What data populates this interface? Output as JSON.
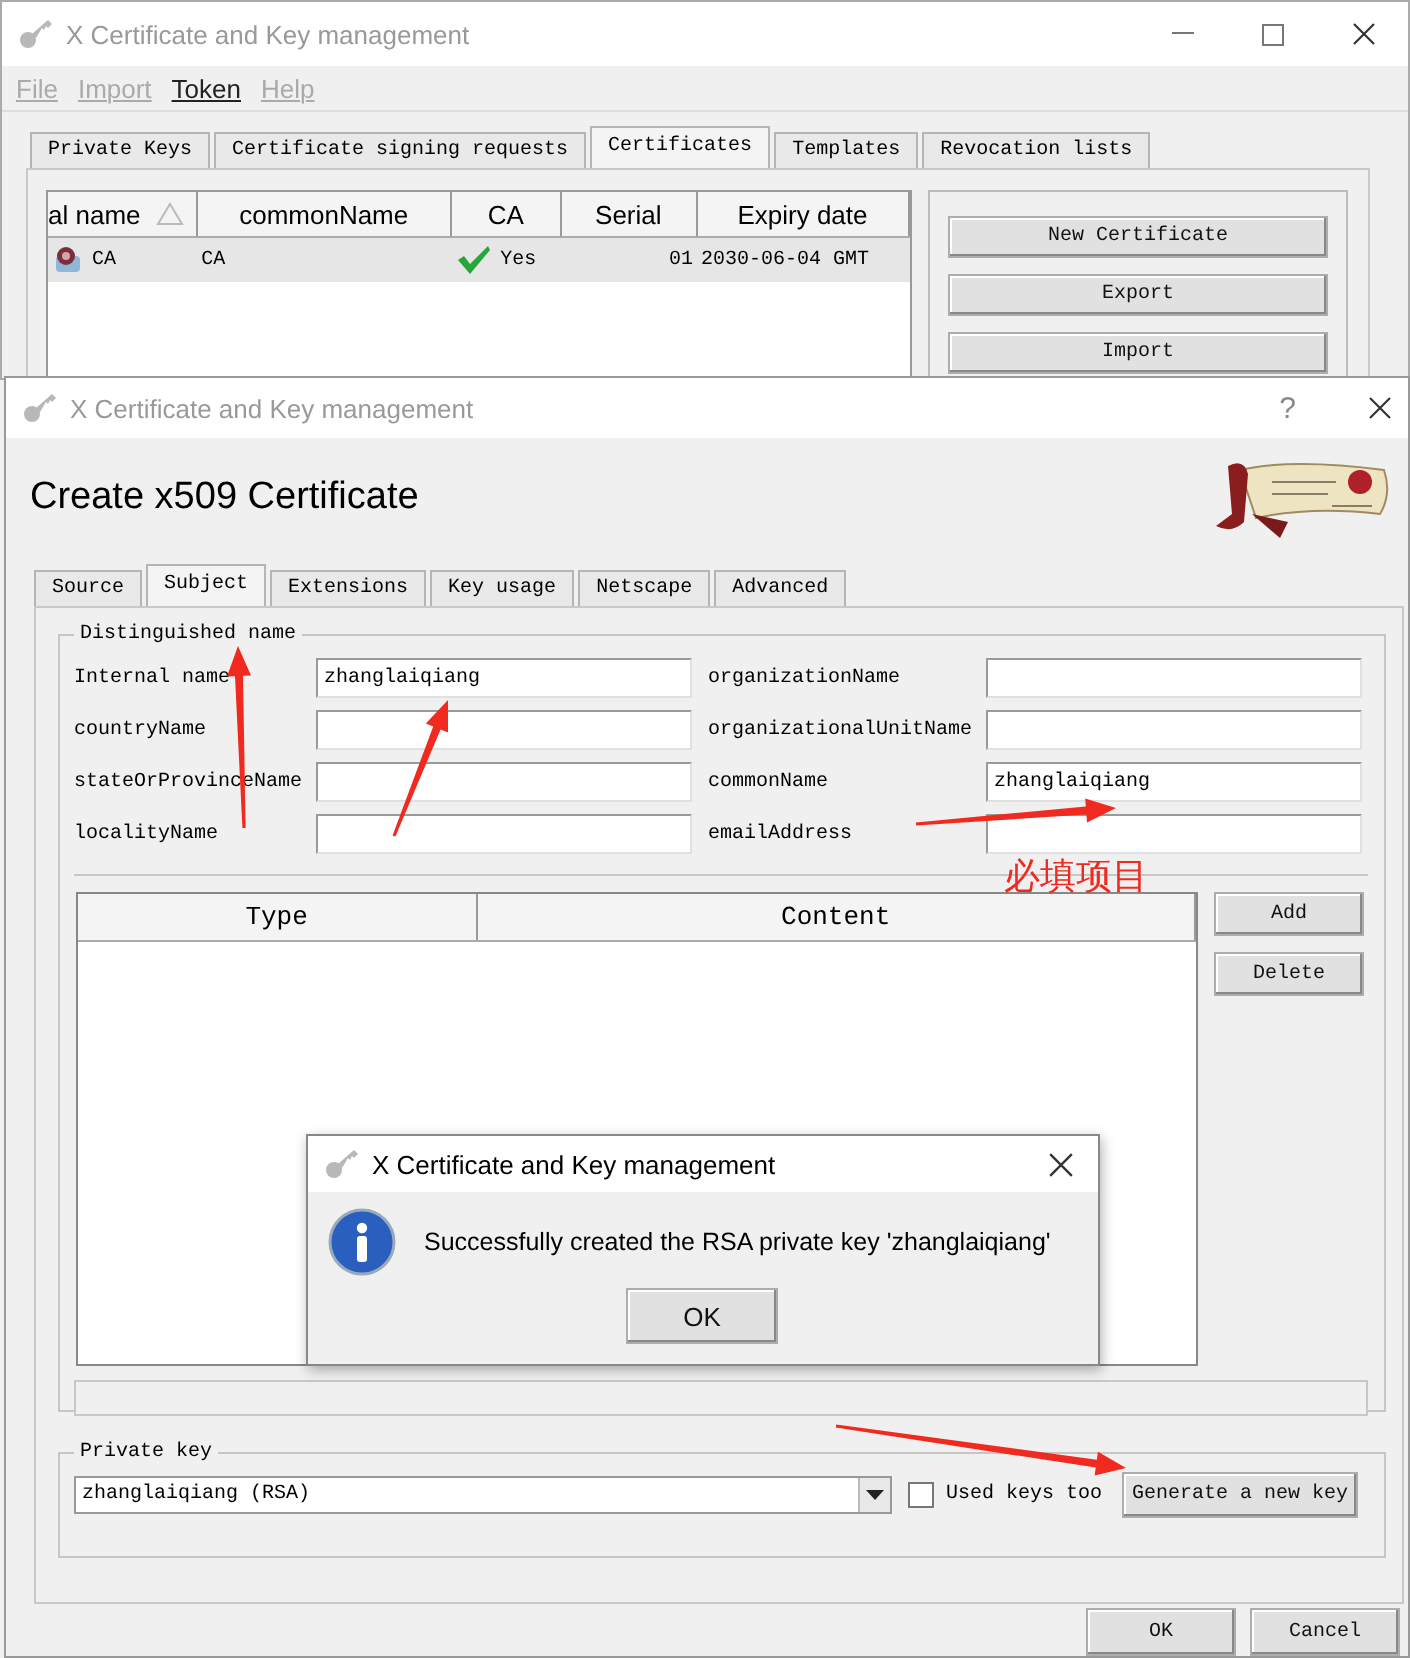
{
  "main_window": {
    "title": "X Certificate and Key management",
    "menu": [
      {
        "label": "File",
        "disabled": true
      },
      {
        "label": "Import",
        "disabled": true
      },
      {
        "label": "Token",
        "disabled": false
      },
      {
        "label": "Help",
        "disabled": true
      }
    ],
    "tabs": [
      {
        "label": "Private Keys",
        "selected": false
      },
      {
        "label": "Certificate signing requests",
        "selected": false
      },
      {
        "label": "Certificates",
        "selected": true
      },
      {
        "label": "Templates",
        "selected": false
      },
      {
        "label": "Revocation lists",
        "selected": false
      }
    ],
    "table": {
      "columns": [
        "al name",
        "commonName",
        "CA",
        "Serial",
        "Expiry date"
      ],
      "rows": [
        {
          "selected": true,
          "ca": true,
          "cells": [
            "CA",
            "CA",
            "Yes",
            "01",
            "2030-06-04 GMT"
          ]
        }
      ]
    },
    "buttons": [
      "New Certificate",
      "Export",
      "Import"
    ]
  },
  "dialog": {
    "title": "X Certificate and Key management",
    "help_button": "?",
    "heading": "Create x509 Certificate",
    "tabs": [
      {
        "label": "Source",
        "selected": false
      },
      {
        "label": "Subject",
        "selected": true
      },
      {
        "label": "Extensions",
        "selected": false
      },
      {
        "label": "Key usage",
        "selected": false
      },
      {
        "label": "Netscape",
        "selected": false
      },
      {
        "label": "Advanced",
        "selected": false
      }
    ],
    "distinguished_name": {
      "legend": "Distinguished name",
      "fields": [
        {
          "label": "Internal name",
          "value": "zhanglaiqiang"
        },
        {
          "label": "organizationName"
        },
        {
          "label": "countryName"
        },
        {
          "label": "organizationalUnitName"
        },
        {
          "label": "stateOrProvinceName"
        },
        {
          "label": "commonName",
          "value": "zhanglaiqiang"
        },
        {
          "label": "localityName"
        },
        {
          "label": "emailAddress"
        }
      ],
      "table": {
        "columns": [
          "Type",
          "Content"
        ]
      },
      "buttons": [
        "Add",
        "Delete"
      ]
    },
    "private_key": {
      "legend": "Private key",
      "selection": "zhanglaiqiang (RSA)",
      "used_keys_too": {
        "label": "Used keys too",
        "checked": false
      },
      "button": "Generate a new key"
    },
    "footer_buttons": [
      "OK",
      "Cancel"
    ]
  },
  "message_box": {
    "title": "X Certificate and Key management",
    "message": "Successfully created the RSA private key 'zhanglaiqiang'",
    "button": "OK"
  },
  "annotation": {
    "note": "必填项目"
  }
}
